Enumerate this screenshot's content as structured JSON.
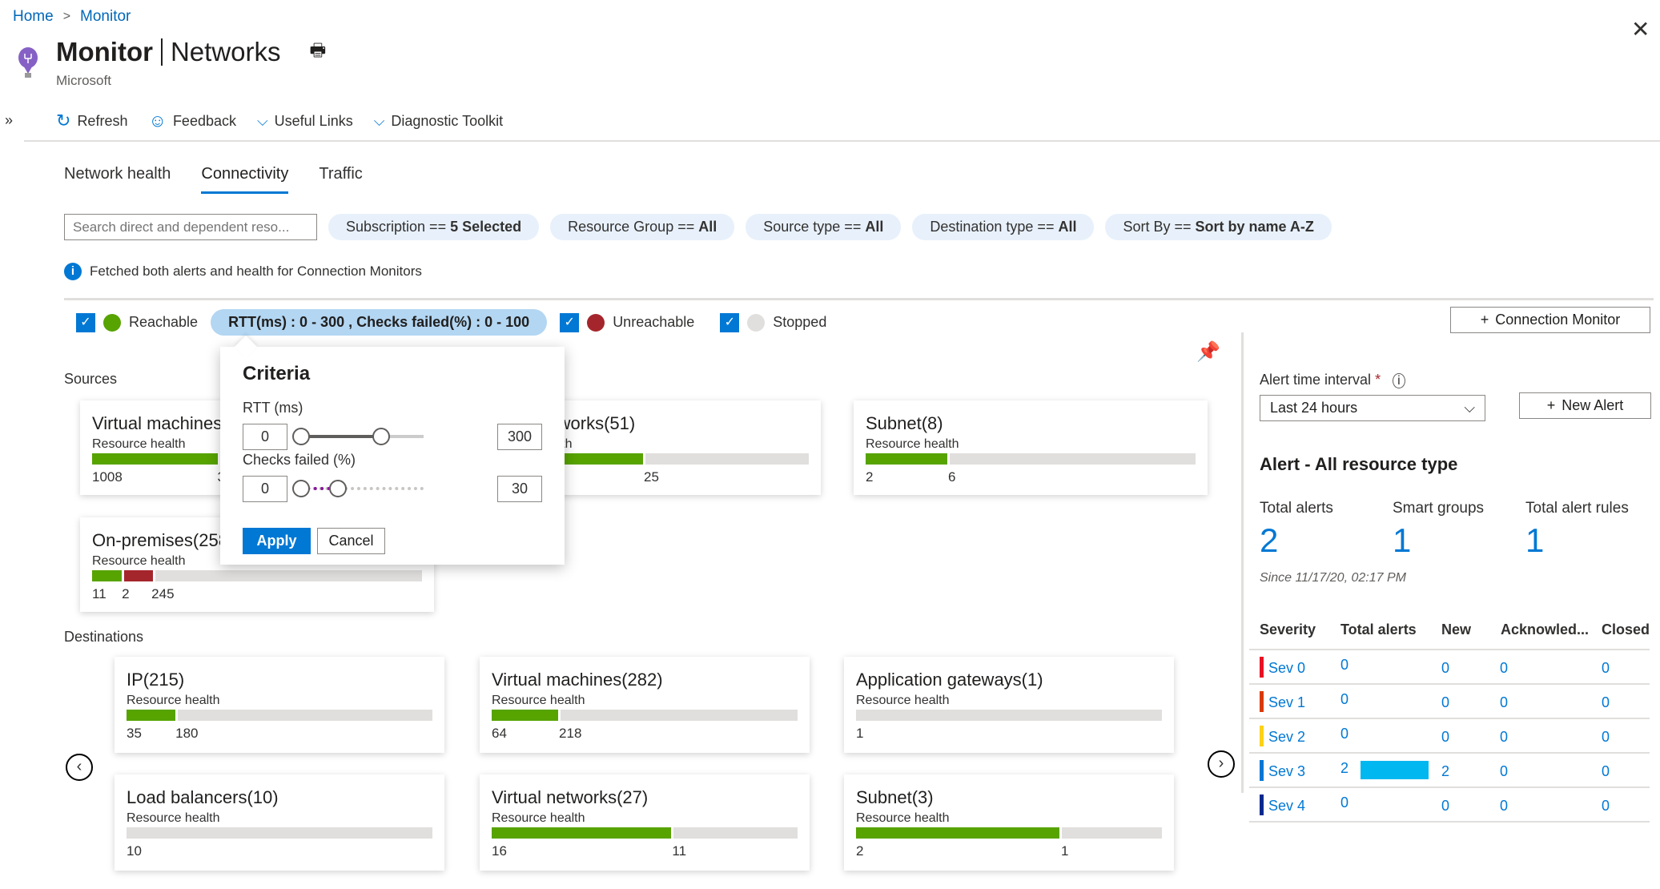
{
  "breadcrumb": {
    "home": "Home",
    "current": "Monitor"
  },
  "header": {
    "title_main": "Monitor",
    "title_sub": "Networks",
    "publisher": "Microsoft"
  },
  "toolbar": {
    "refresh": "Refresh",
    "feedback": "Feedback",
    "useful_links": "Useful Links",
    "diagnostic": "Diagnostic Toolkit"
  },
  "tabs": [
    {
      "label": "Network health"
    },
    {
      "label": "Connectivity",
      "selected": true
    },
    {
      "label": "Traffic"
    }
  ],
  "filters": {
    "search_placeholder": "Search direct and dependent reso...",
    "pills": [
      {
        "k": "Subscription == ",
        "v": "5 Selected"
      },
      {
        "k": "Resource Group == ",
        "v": "All"
      },
      {
        "k": "Source type == ",
        "v": "All"
      },
      {
        "k": "Destination type == ",
        "v": "All"
      },
      {
        "k": "Sort By == ",
        "v": "Sort by name A-Z"
      }
    ]
  },
  "info": "Fetched both alerts and health for Connection Monitors",
  "legend": {
    "reachable": "Reachable",
    "criteria": "RTT(ms) : 0 - 300 , Checks failed(%) : 0 - 100",
    "unreachable": "Unreachable",
    "stopped": "Stopped",
    "colors": {
      "reachable": "#57a300",
      "unreachable": "#a4262c",
      "stopped": "#e1dfdd"
    }
  },
  "connection_monitor_button": "Connection Monitor",
  "sources_label": "Sources",
  "destinations_label": "Destinations",
  "health_label": "Resource health",
  "sources": [
    {
      "title": "Virtual machines",
      "segments": [
        {
          "c": "g",
          "v": "1008",
          "w": 38
        },
        {
          "c": "r",
          "v": "3",
          "w": 4
        }
      ]
    },
    {
      "title": "Virtual networks(51)",
      "segments": [
        {
          "c": "g",
          "v": "",
          "w": 50
        },
        {
          "c": "x",
          "v": "25",
          "w": 50
        }
      ]
    },
    {
      "title": "Subnet(8)",
      "segments": [
        {
          "c": "g",
          "v": "2",
          "w": 25
        },
        {
          "c": "x",
          "v": "6",
          "w": 75
        }
      ]
    },
    {
      "title": "On-premises(258)",
      "segments": [
        {
          "c": "g",
          "v": "11",
          "w": 9
        },
        {
          "c": "r",
          "v": "2",
          "w": 9
        },
        {
          "c": "x",
          "v": "245",
          "w": 82
        }
      ]
    }
  ],
  "destinations": [
    {
      "title": "IP(215)",
      "segments": [
        {
          "c": "g",
          "v": "35",
          "w": 16
        },
        {
          "c": "x",
          "v": "180",
          "w": 84
        }
      ]
    },
    {
      "title": "Virtual machines(282)",
      "segments": [
        {
          "c": "g",
          "v": "64",
          "w": 22
        },
        {
          "c": "x",
          "v": "218",
          "w": 78
        }
      ]
    },
    {
      "title": "Application gateways(1)",
      "segments": [
        {
          "c": "x",
          "v": "1",
          "w": 100
        }
      ]
    },
    {
      "title": "Load balancers(10)",
      "segments": [
        {
          "c": "x",
          "v": "10",
          "w": 100
        }
      ]
    },
    {
      "title": "Virtual networks(27)",
      "segments": [
        {
          "c": "g",
          "v": "16",
          "w": 59
        },
        {
          "c": "x",
          "v": "11",
          "w": 41
        }
      ]
    },
    {
      "title": "Subnet(3)",
      "segments": [
        {
          "c": "g",
          "v": "2",
          "w": 67
        },
        {
          "c": "x",
          "v": "1",
          "w": 33
        }
      ]
    }
  ],
  "criteria": {
    "title": "Criteria",
    "rtt_label": "RTT (ms)",
    "rtt_min": "0",
    "rtt_max": "300",
    "rtt_value_fraction": 0.65,
    "checks_label": "Checks failed (%)",
    "checks_min": "0",
    "checks_max": "30",
    "checks_value_fraction": 0.3,
    "apply": "Apply",
    "cancel": "Cancel"
  },
  "alerts": {
    "interval_label": "Alert time interval",
    "required": "*",
    "interval_value": "Last 24 hours",
    "new_alert": "New Alert",
    "heading": "Alert - All resource type",
    "stats": [
      {
        "label": "Total alerts",
        "value": "2"
      },
      {
        "label": "Smart groups",
        "value": "1"
      },
      {
        "label": "Total alert rules",
        "value": "1"
      }
    ],
    "since": "Since 11/17/20, 02:17 PM",
    "columns": [
      "Severity",
      "Total alerts",
      "New",
      "Acknowled...",
      "Closed"
    ],
    "rows": [
      {
        "sev": "Sev 0",
        "color": "#e81123",
        "total": "0",
        "new": "0",
        "ack": "0",
        "closed": "0",
        "bar": 0
      },
      {
        "sev": "Sev 1",
        "color": "#d83b01",
        "total": "0",
        "new": "0",
        "ack": "0",
        "closed": "0",
        "bar": 0
      },
      {
        "sev": "Sev 2",
        "color": "#fcd116",
        "total": "0",
        "new": "0",
        "ack": "0",
        "closed": "0",
        "bar": 0
      },
      {
        "sev": "Sev 3",
        "color": "#0078d4",
        "total": "2",
        "new": "2",
        "ack": "0",
        "closed": "0",
        "bar": 1
      },
      {
        "sev": "Sev 4",
        "color": "#002a8f",
        "total": "0",
        "new": "0",
        "ack": "0",
        "closed": "0",
        "bar": 0
      }
    ]
  }
}
